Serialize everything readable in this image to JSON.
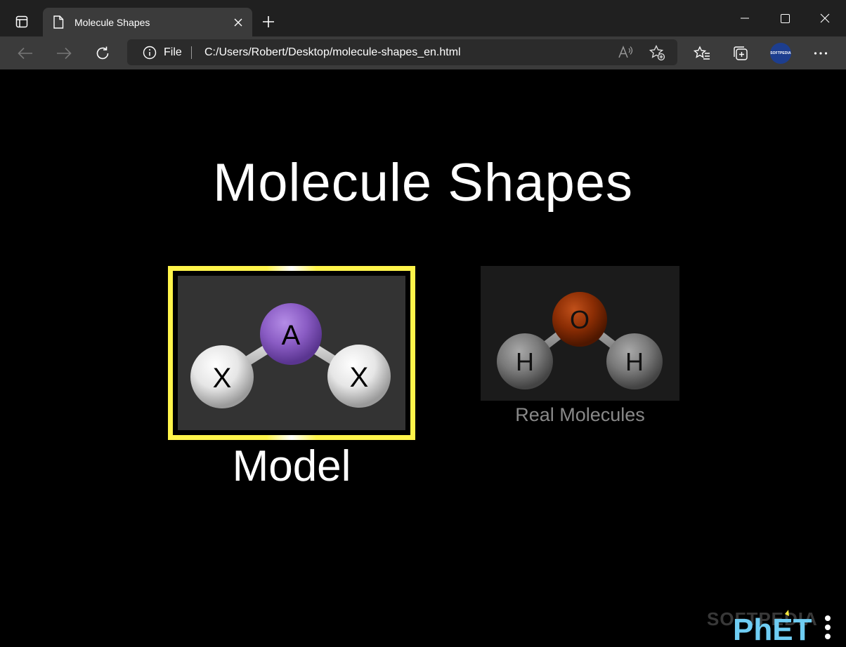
{
  "browser": {
    "tab_title": "Molecule Shapes",
    "address_scheme": "File",
    "address_url": "C:/Users/Robert/Desktop/molecule-shapes_en.html",
    "profile_label": "SOFTPEDIA"
  },
  "app": {
    "title": "Molecule Shapes",
    "screens": [
      {
        "label": "Model",
        "selected": true,
        "atoms": {
          "center": "A",
          "left": "X",
          "right": "X"
        }
      },
      {
        "label": "Real Molecules",
        "selected": false,
        "atoms": {
          "center": "O",
          "left": "H",
          "right": "H"
        }
      }
    ],
    "logo": "PhET",
    "watermark": "SOFTPEDIA"
  },
  "colors": {
    "selection_frame": "#fff44a",
    "center_atom_model": "#8a5cc4",
    "center_atom_real": "#8b2d04",
    "outer_atom_model": "#e8e8e8",
    "outer_atom_real": "#7a7a7a"
  },
  "icons": [
    "tab-actions-icon",
    "page-icon",
    "close-icon",
    "plus-icon",
    "minimize-icon",
    "maximize-icon",
    "back-arrow-icon",
    "forward-arrow-icon",
    "refresh-icon",
    "info-icon",
    "read-aloud-icon",
    "add-favorite-icon",
    "favorites-icon",
    "collections-icon",
    "more-icon",
    "phet-menu-icon"
  ]
}
